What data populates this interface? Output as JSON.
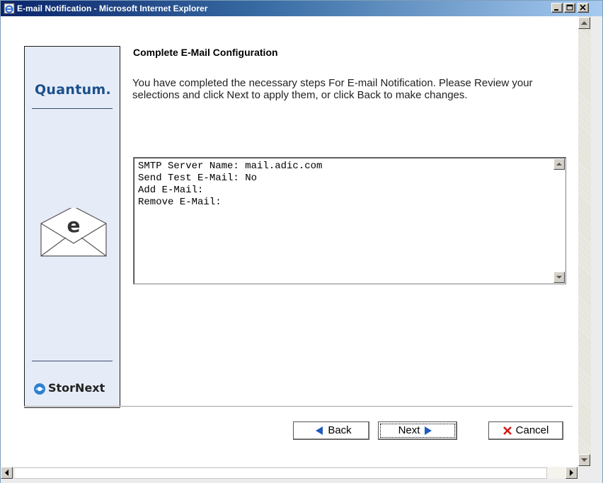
{
  "window": {
    "title": "E-mail Notification - Microsoft Internet Explorer"
  },
  "brand": {
    "top_logo": "Quantum.",
    "bottom_logo": "StorNext",
    "panel_icon": "email-envelope-icon",
    "panel_icon_letter": "e"
  },
  "main": {
    "heading": "Complete E-Mail Configuration",
    "description": "You have completed the necessary steps For E-mail Notification. Please Review your selections and click Next to apply them, or click Back to make changes.",
    "summary_lines": [
      "SMTP Server Name: mail.adic.com",
      "Send Test E-Mail: No",
      "Add E-Mail:",
      "Remove E-Mail:"
    ]
  },
  "buttons": {
    "back_label": "Back",
    "next_label": "Next",
    "cancel_label": "Cancel"
  },
  "colors": {
    "title_bar_start": "#0a246a",
    "title_bar_end": "#a6caf0",
    "brand_blue": "#1b4f8c",
    "panel_bg": "#e6ecf7",
    "button_arrow_blue": "#1f5bbf",
    "cancel_x_red": "#d01818"
  }
}
